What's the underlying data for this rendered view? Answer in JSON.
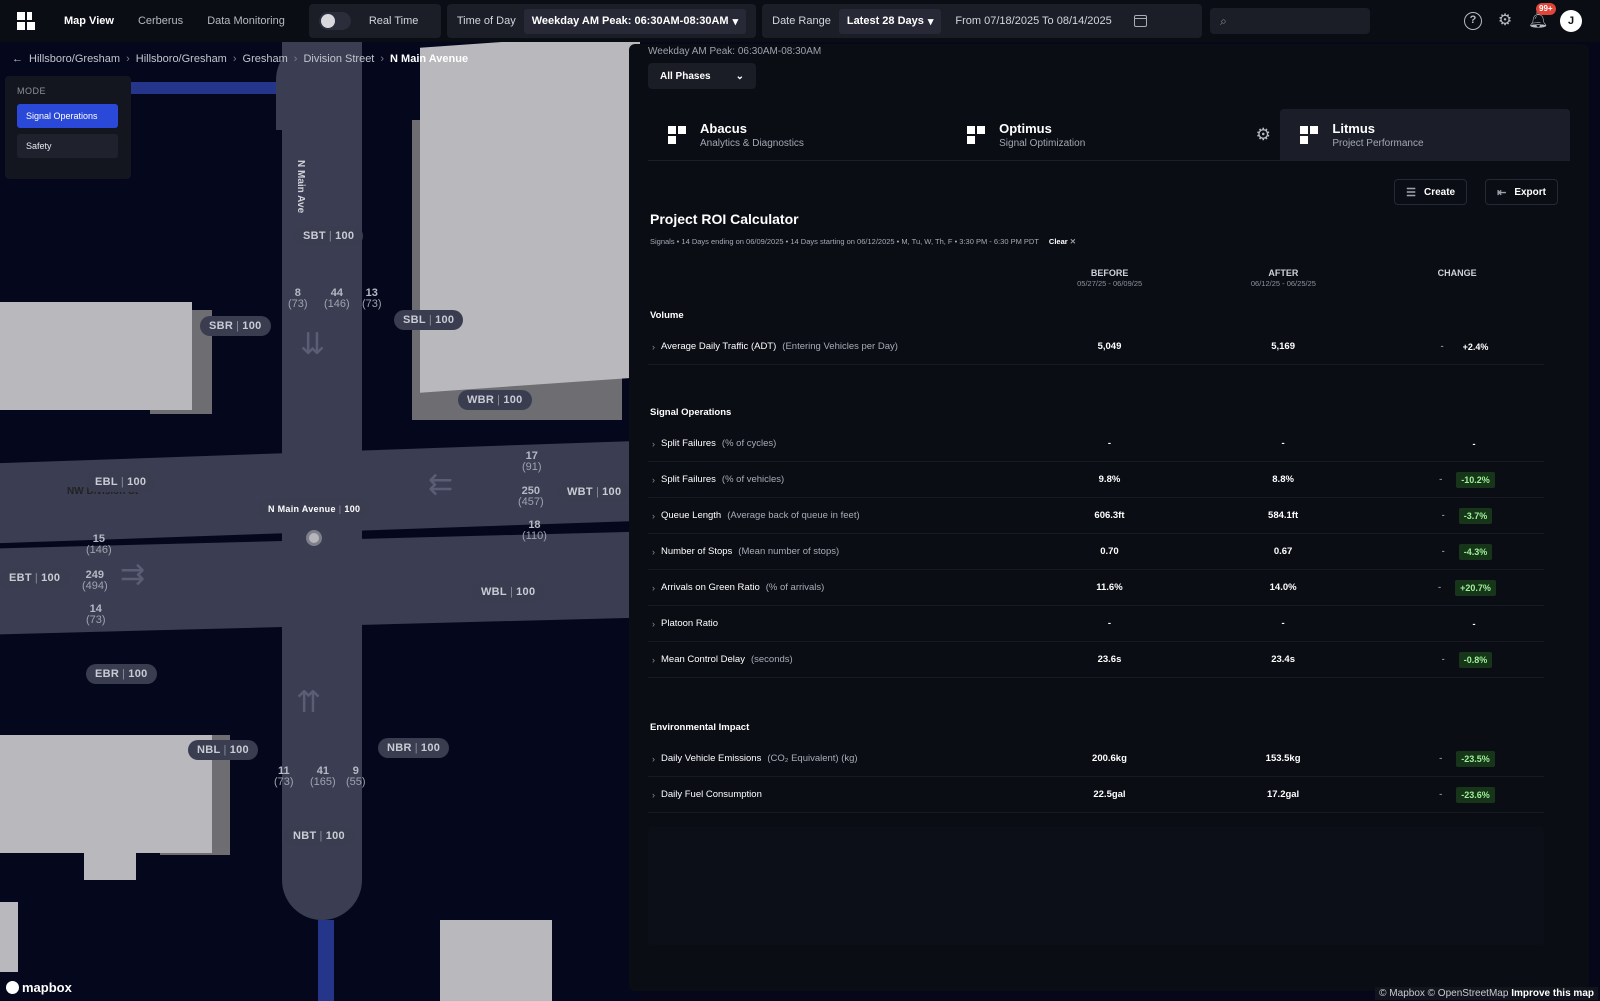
{
  "nav": {
    "tabs": [
      "Map View",
      "Cerberus",
      "Data Monitoring"
    ],
    "real_time_label": "Real Time",
    "time_of_day_label": "Time of Day",
    "time_of_day_value": "Weekday AM Peak: 06:30AM-08:30AM",
    "date_range_label": "Date Range",
    "date_range_value": "Latest 28 Days",
    "date_span": "From 07/18/2025 To 08/14/2025",
    "notifications_badge": "99+",
    "avatar_initial": "J"
  },
  "breadcrumb": [
    "Hillsboro/Gresham",
    "Hillsboro/Gresham",
    "Gresham",
    "Division Street",
    "N Main Avenue"
  ],
  "mode": {
    "title": "MODE",
    "options": [
      "Signal Operations",
      "Safety"
    ],
    "selected": "Signal Operations"
  },
  "map": {
    "street_vertical": "N Main Ave",
    "street_horizontal": "NW Division St",
    "intersection_label": "N Main Avenue",
    "intersection_value": "100",
    "approaches": [
      {
        "code": "SBT",
        "value": "100"
      },
      {
        "code": "SBR",
        "value": "100"
      },
      {
        "code": "SBL",
        "value": "100"
      },
      {
        "code": "WBR",
        "value": "100"
      },
      {
        "code": "EBL",
        "value": "100"
      },
      {
        "code": "WBT",
        "value": "100"
      },
      {
        "code": "EBT",
        "value": "100"
      },
      {
        "code": "WBL",
        "value": "100"
      },
      {
        "code": "EBR",
        "value": "100"
      },
      {
        "code": "NBL",
        "value": "100"
      },
      {
        "code": "NBR",
        "value": "100"
      },
      {
        "code": "NBT",
        "value": "100"
      }
    ],
    "counts": {
      "south_bound": [
        {
          "v": "8",
          "s": "(73)"
        },
        {
          "v": "44",
          "s": "(146)"
        },
        {
          "v": "13",
          "s": "(73)"
        }
      ],
      "west_bound": [
        {
          "v": "17",
          "s": "(91)"
        },
        {
          "v": "250",
          "s": "(457)"
        },
        {
          "v": "18",
          "s": "(110)"
        }
      ],
      "east_bound": [
        {
          "v": "15",
          "s": "(146)"
        },
        {
          "v": "249",
          "s": "(494)"
        },
        {
          "v": "14",
          "s": "(73)"
        }
      ],
      "north_bound": [
        {
          "v": "11",
          "s": "(73)"
        },
        {
          "v": "41",
          "s": "(165)"
        },
        {
          "v": "9",
          "s": "(55)"
        }
      ]
    },
    "logo": "mapbox",
    "attribution": "© Mapbox © OpenStreetMap",
    "attribution_link": "Improve this map"
  },
  "panel": {
    "peak_note": "Weekday AM Peak: 06:30AM-08:30AM",
    "phase_select": "All Phases",
    "products": [
      {
        "name": "Abacus",
        "sub": "Analytics & Diagnostics"
      },
      {
        "name": "Optimus",
        "sub": "Signal Optimization"
      },
      {
        "name": "Litmus",
        "sub": "Project Performance"
      }
    ],
    "create_label": "Create",
    "export_label": "Export",
    "title": "Project ROI Calculator",
    "subtitle": "Signals • 14 Days ending on 06/09/2025 • 14 Days starting on 06/12/2025 • M, Tu, W, Th, F • 3:30 PM - 6:30 PM PDT",
    "clear_label": "Clear",
    "columns": {
      "before": "BEFORE",
      "before_range": "05/27/25 - 06/09/25",
      "after": "AFTER",
      "after_range": "06/12/25 - 06/25/25",
      "change": "CHANGE"
    },
    "sections": [
      {
        "title": "Volume",
        "rows": [
          {
            "label": "Average Daily Traffic (ADT)",
            "unit": "(Entering Vehicles per Day)",
            "before": "5,049",
            "after": "5,169",
            "indicator": "-",
            "change": "+2.4%",
            "tone": "neutral"
          }
        ]
      },
      {
        "title": "Signal Operations",
        "rows": [
          {
            "label": "Split Failures",
            "unit": "(% of cycles)",
            "before": "-",
            "after": "-",
            "indicator": "",
            "change": "-",
            "tone": "neutral"
          },
          {
            "label": "Split Failures",
            "unit": "(% of vehicles)",
            "before": "9.8%",
            "after": "8.8%",
            "indicator": "-",
            "change": "-10.2%",
            "tone": "good"
          },
          {
            "label": "Queue Length",
            "unit": "(Average back of queue in feet)",
            "before": "606.3ft",
            "after": "584.1ft",
            "indicator": "-",
            "change": "-3.7%",
            "tone": "good"
          },
          {
            "label": "Number of Stops",
            "unit": "(Mean number of stops)",
            "before": "0.70",
            "after": "0.67",
            "indicator": "-",
            "change": "-4.3%",
            "tone": "good"
          },
          {
            "label": "Arrivals on Green Ratio",
            "unit": "(% of arrivals)",
            "before": "11.6%",
            "after": "14.0%",
            "indicator": "-",
            "change": "+20.7%",
            "tone": "good"
          },
          {
            "label": "Platoon Ratio",
            "unit": "",
            "before": "-",
            "after": "-",
            "indicator": "",
            "change": "-",
            "tone": "neutral"
          },
          {
            "label": "Mean Control Delay",
            "unit": "(seconds)",
            "before": "23.6s",
            "after": "23.4s",
            "indicator": "-",
            "change": "-0.8%",
            "tone": "good"
          }
        ]
      },
      {
        "title": "Environmental Impact",
        "rows": [
          {
            "label": "Daily Vehicle Emissions",
            "unit": "(CO₂ Equivalent) (kg)",
            "before": "200.6kg",
            "after": "153.5kg",
            "indicator": "-",
            "change": "-23.5%",
            "tone": "good"
          },
          {
            "label": "Daily Fuel Consumption",
            "unit": "",
            "before": "22.5gal",
            "after": "17.2gal",
            "indicator": "-",
            "change": "-23.6%",
            "tone": "good"
          }
        ]
      }
    ]
  },
  "colors": {
    "accent": "#2b49d8",
    "good_bg": "#173619",
    "good_text": "#9ef199",
    "road": "#3b3e52",
    "river": "#25358a"
  }
}
